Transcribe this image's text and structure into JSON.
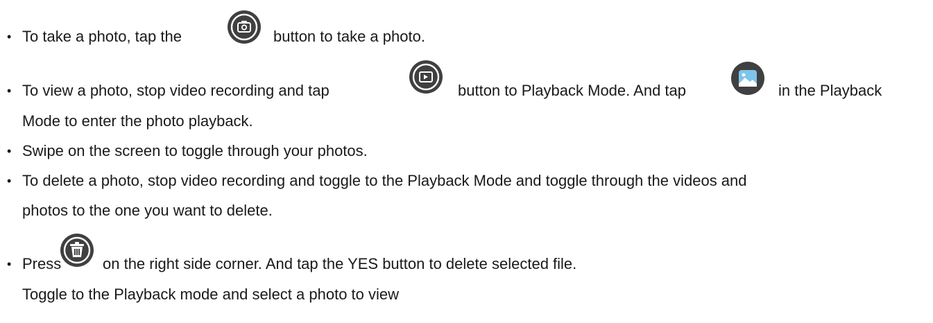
{
  "items": [
    {
      "text_a": "To take a photo, tap the",
      "icon": "camera-shutter-icon",
      "text_b": "button to take a photo."
    },
    {
      "text_a": "To view a photo, stop video recording and tap",
      "icon": "playback-mode-icon",
      "text_b": "button to Playback Mode. And tap",
      "icon2": "gallery-image-icon",
      "text_c": "in the Playback",
      "cont": "Mode to enter the photo playback."
    },
    {
      "text_a": "Swipe on the screen to toggle through your photos."
    },
    {
      "text_a": "To delete a photo, stop video recording and toggle to the Playback Mode and toggle through the videos and",
      "cont": "photos to the one you want to delete."
    },
    {
      "text_a": "Press",
      "icon": "trash-delete-icon",
      "text_b": "on the right side corner. And tap the YES button to delete selected file.",
      "cont": "Toggle to the Playback mode and select a photo to view"
    }
  ],
  "colors": {
    "icon_fill": "#404040",
    "text": "#1a1a1a"
  }
}
